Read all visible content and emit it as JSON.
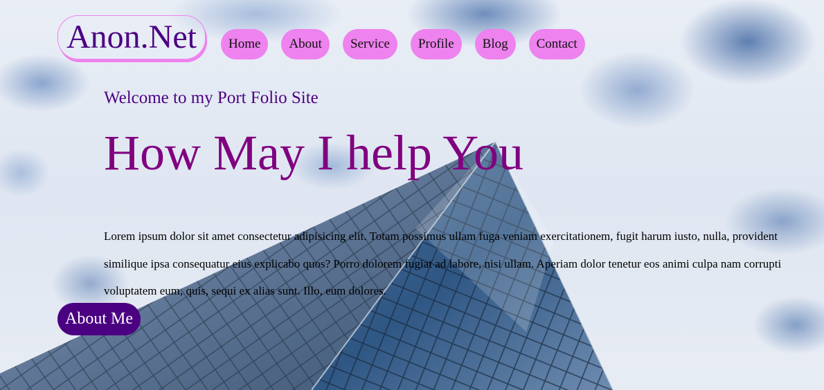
{
  "header": {
    "logo_text": "Anon.Net",
    "nav": [
      {
        "label": "Home"
      },
      {
        "label": "About"
      },
      {
        "label": "Service"
      },
      {
        "label": "Profile"
      },
      {
        "label": "Blog"
      },
      {
        "label": "Contact"
      }
    ]
  },
  "hero": {
    "welcome": "Welcome to my Port Folio Site",
    "headline": "How May I help You",
    "paragraph": "Lorem ipsum dolor sit amet consectetur adipisicing elit. Totam possimus ullam fuga veniam exercitationem, fugit harum iusto, nulla, provident similique ipsa consequatur eius explicabo quos? Porro dolorem fugiat ad labore, nisi ullam. Aperiam dolor tenetur eos animi culpa nam corrupti voluptatem eum, quis, sequi ex alias sunt. Illo, eum dolores.",
    "cta_label": "About Me"
  },
  "colors": {
    "logo_text": "#4b0082",
    "logo_border": "#ee82ee",
    "nav_button_bg": "#ee82ee",
    "welcome_text": "#4b0082",
    "headline_text": "#800080",
    "cta_bg": "#4b0082",
    "cta_text": "#ffffff"
  },
  "background": {
    "description_icon": "sky-skyscraper-image"
  }
}
